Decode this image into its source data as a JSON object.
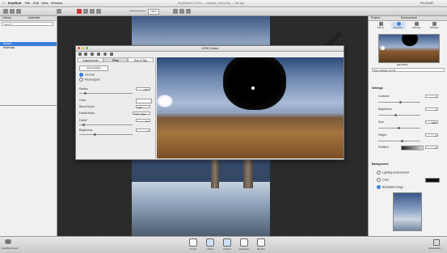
{
  "menubar": {
    "app": "KeyShot",
    "items": [
      "File",
      "Edit",
      "View",
      "Window"
    ],
    "title": "KeyShot 5.2 Pro — tutorial_v001.bip — 99 fps",
    "clock": "Fri 21:57"
  },
  "toolbar": {
    "zoom": "100%"
  },
  "left_panel": {
    "tabs": [
      "Library",
      "Materials"
    ],
    "search_placeholder": "Search",
    "items": [
      "Scene",
      "Materials"
    ]
  },
  "right_panel": {
    "header": "Project",
    "sub_header": "Environment",
    "tabs": [
      "Scene",
      "Environ.",
      "Camera",
      "Settings"
    ],
    "thumb_caption": "Edit HDRI",
    "hdri_file": "field_daylight_v3.hdr",
    "sections": {
      "settings": "Settings",
      "background": "Background"
    },
    "settings": [
      {
        "label": "Contrast",
        "value": "1"
      },
      {
        "label": "Brightness",
        "value": "1"
      },
      {
        "label": "Size",
        "value": "1000"
      },
      {
        "label": "Height",
        "value": "0"
      },
      {
        "label": "Rotation",
        "value": "0"
      }
    ],
    "background_options": [
      "Lighting Environment",
      "Color",
      "Backplate Image"
    ],
    "accent_color": "#3b7fd9"
  },
  "dialog": {
    "title": "HDRI Editor",
    "tabs": [
      "Adjustments",
      "Pins",
      "Sun & Sky"
    ],
    "add_pin": "Add Highlight",
    "shape_options": [
      "Circular",
      "Rectangular"
    ],
    "rows": [
      {
        "label": "Radius",
        "value": "20.0"
      },
      {
        "label": "Color",
        "value": ""
      },
      {
        "label": "Blend Mode",
        "value": "Add"
      },
      {
        "label": "Falloff Mode",
        "value": "From edge"
      },
      {
        "label": "Falloff",
        "value": "0.1"
      },
      {
        "label": "Brightness",
        "value": "1"
      }
    ]
  },
  "bottom_bar": {
    "cloud": "KeyShot Cloud",
    "buttons": [
      "Import",
      "Library",
      "Project",
      "Animation",
      "Render"
    ],
    "right_label": "Screenshot"
  }
}
